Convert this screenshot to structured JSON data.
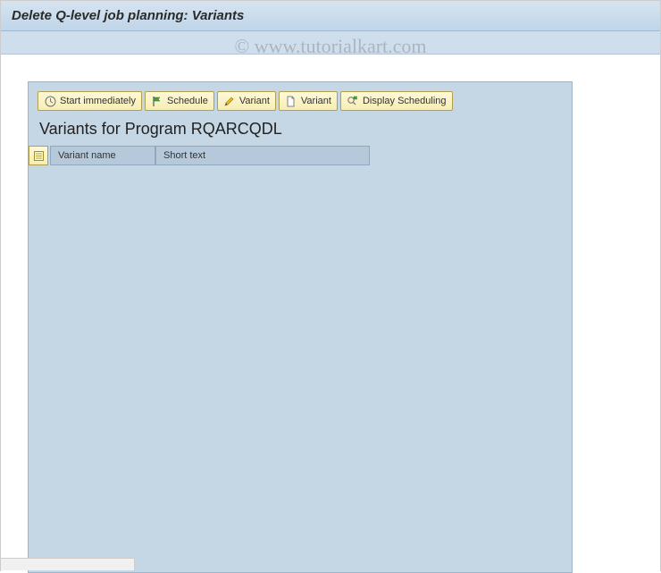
{
  "title": "Delete Q-level job planning: Variants",
  "watermark": "© www.tutorialkart.com",
  "toolbar": {
    "start_immediately": "Start immediately",
    "schedule": "Schedule",
    "variant_edit": "Variant",
    "variant_new": "Variant",
    "display_scheduling": "Display Scheduling"
  },
  "heading": "Variants for Program RQARCQDL",
  "columns": {
    "variant_name": "Variant name",
    "short_text": "Short text"
  }
}
